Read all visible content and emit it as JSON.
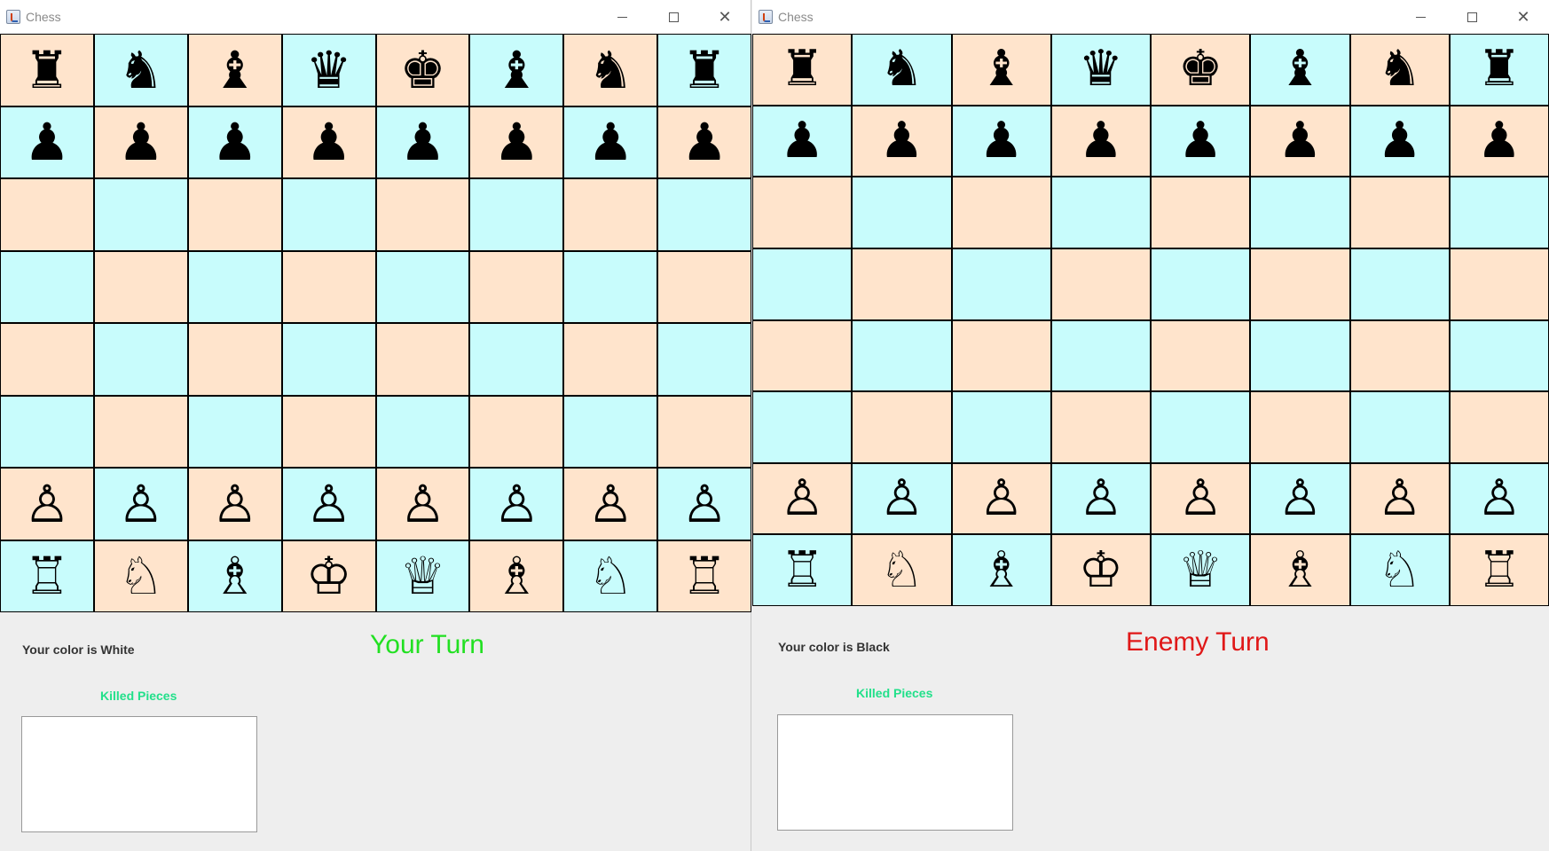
{
  "colors": {
    "peach_square": "#ffe4cc",
    "cyan_square": "#c8fcfc",
    "your_turn": "#22e022",
    "enemy_turn": "#e01818",
    "killed_label": "#22e08a"
  },
  "windows": [
    {
      "title": "Chess",
      "minimize_icon": "minimize-icon",
      "maximize_icon": "maximize-icon",
      "close_icon": "close-icon",
      "close_glyph": "✕",
      "player_color_text": "Your color is White",
      "turn_text": "Your Turn",
      "turn_color": "#22e022",
      "killed_label": "Killed Pieces",
      "killed_pieces": [],
      "board": [
        [
          "♜",
          "♞",
          "♝",
          "♛",
          "♚",
          "♝",
          "♞",
          "♜"
        ],
        [
          "♟",
          "♟",
          "♟",
          "♟",
          "♟",
          "♟",
          "♟",
          "♟"
        ],
        [
          "",
          "",
          "",
          "",
          "",
          "",
          "",
          ""
        ],
        [
          "",
          "",
          "",
          "",
          "",
          "",
          "",
          ""
        ],
        [
          "",
          "",
          "",
          "",
          "",
          "",
          "",
          ""
        ],
        [
          "",
          "",
          "",
          "",
          "",
          "",
          "",
          ""
        ],
        [
          "♙",
          "♙",
          "♙",
          "♙",
          "♙",
          "♙",
          "♙",
          "♙"
        ],
        [
          "♖",
          "♘",
          "♗",
          "♔",
          "♕",
          "♗",
          "♘",
          "♖"
        ]
      ]
    },
    {
      "title": "Chess",
      "minimize_icon": "minimize-icon",
      "maximize_icon": "maximize-icon",
      "close_icon": "close-icon",
      "close_glyph": "✕",
      "player_color_text": "Your color is Black",
      "turn_text": "Enemy Turn",
      "turn_color": "#e01818",
      "killed_label": "Killed Pieces",
      "killed_pieces": [],
      "board": [
        [
          "♜",
          "♞",
          "♝",
          "♛",
          "♚",
          "♝",
          "♞",
          "♜"
        ],
        [
          "♟",
          "♟",
          "♟",
          "♟",
          "♟",
          "♟",
          "♟",
          "♟"
        ],
        [
          "",
          "",
          "",
          "",
          "",
          "",
          "",
          ""
        ],
        [
          "",
          "",
          "",
          "",
          "",
          "",
          "",
          ""
        ],
        [
          "",
          "",
          "",
          "",
          "",
          "",
          "",
          ""
        ],
        [
          "",
          "",
          "",
          "",
          "",
          "",
          "",
          ""
        ],
        [
          "♙",
          "♙",
          "♙",
          "♙",
          "♙",
          "♙",
          "♙",
          "♙"
        ],
        [
          "♖",
          "♘",
          "♗",
          "♔",
          "♕",
          "♗",
          "♘",
          "♖"
        ]
      ]
    }
  ]
}
